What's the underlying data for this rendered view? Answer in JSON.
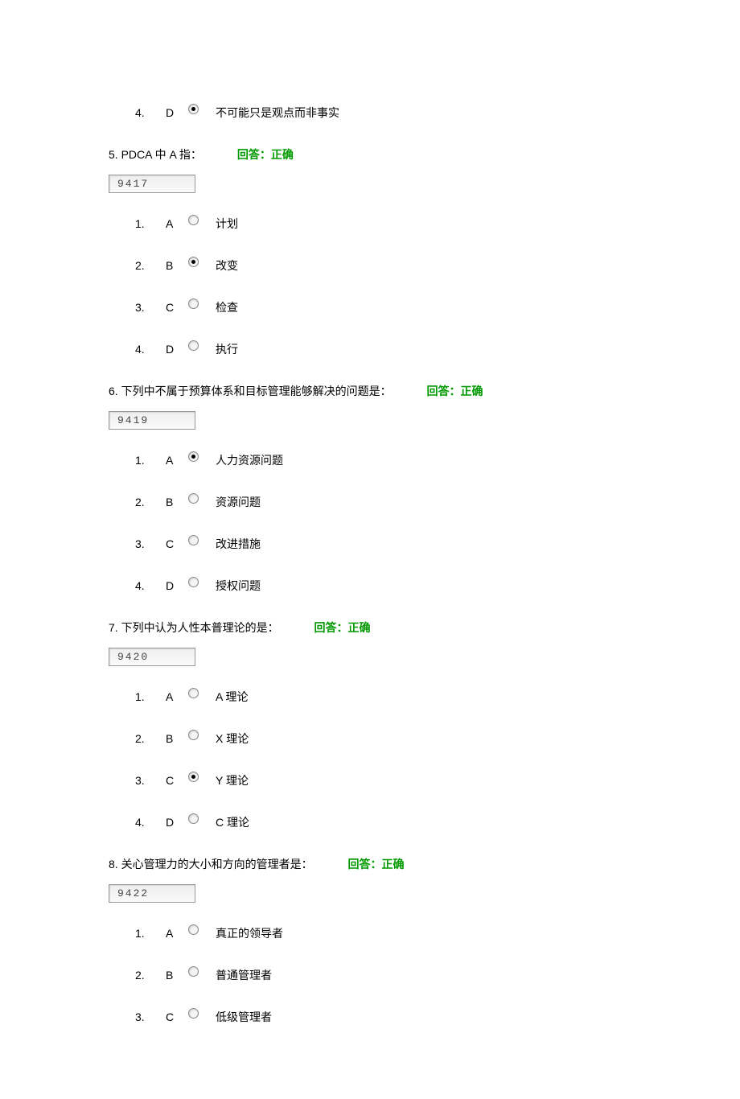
{
  "q4_orphan": {
    "num": "4.",
    "letter": "D",
    "selected": true,
    "text": "不可能只是观点而非事实"
  },
  "q5": {
    "header_prefix": "5. PDCA 中 A 指：",
    "feedback": "回答：正确",
    "code": "9417",
    "options": [
      {
        "num": "1.",
        "letter": "A",
        "selected": false,
        "text": "计划"
      },
      {
        "num": "2.",
        "letter": "B",
        "selected": true,
        "text": "改变"
      },
      {
        "num": "3.",
        "letter": "C",
        "selected": false,
        "text": "检查"
      },
      {
        "num": "4.",
        "letter": "D",
        "selected": false,
        "text": "执行"
      }
    ]
  },
  "q6": {
    "header_prefix": "6. 下列中不属于预算体系和目标管理能够解决的问题是：",
    "feedback": "回答：正确",
    "code": "9419",
    "options": [
      {
        "num": "1.",
        "letter": "A",
        "selected": true,
        "text": "人力资源问题"
      },
      {
        "num": "2.",
        "letter": "B",
        "selected": false,
        "text": "资源问题"
      },
      {
        "num": "3.",
        "letter": "C",
        "selected": false,
        "text": "改进措施"
      },
      {
        "num": "4.",
        "letter": "D",
        "selected": false,
        "text": "授权问题"
      }
    ]
  },
  "q7": {
    "header_prefix": "7. 下列中认为人性本普理论的是：",
    "feedback": "回答：正确",
    "code": "9420",
    "options": [
      {
        "num": "1.",
        "letter": "A",
        "selected": false,
        "text": "A 理论"
      },
      {
        "num": "2.",
        "letter": "B",
        "selected": false,
        "text": "X 理论"
      },
      {
        "num": "3.",
        "letter": "C",
        "selected": true,
        "text": "Y 理论"
      },
      {
        "num": "4.",
        "letter": "D",
        "selected": false,
        "text": "C 理论"
      }
    ]
  },
  "q8": {
    "header_prefix": "8. 关心管理力的大小和方向的管理者是：",
    "feedback": "回答：正确",
    "code": "9422",
    "options": [
      {
        "num": "1.",
        "letter": "A",
        "selected": false,
        "text": "真正的领导者"
      },
      {
        "num": "2.",
        "letter": "B",
        "selected": false,
        "text": "普通管理者"
      },
      {
        "num": "3.",
        "letter": "C",
        "selected": false,
        "text": "低级管理者"
      }
    ]
  }
}
